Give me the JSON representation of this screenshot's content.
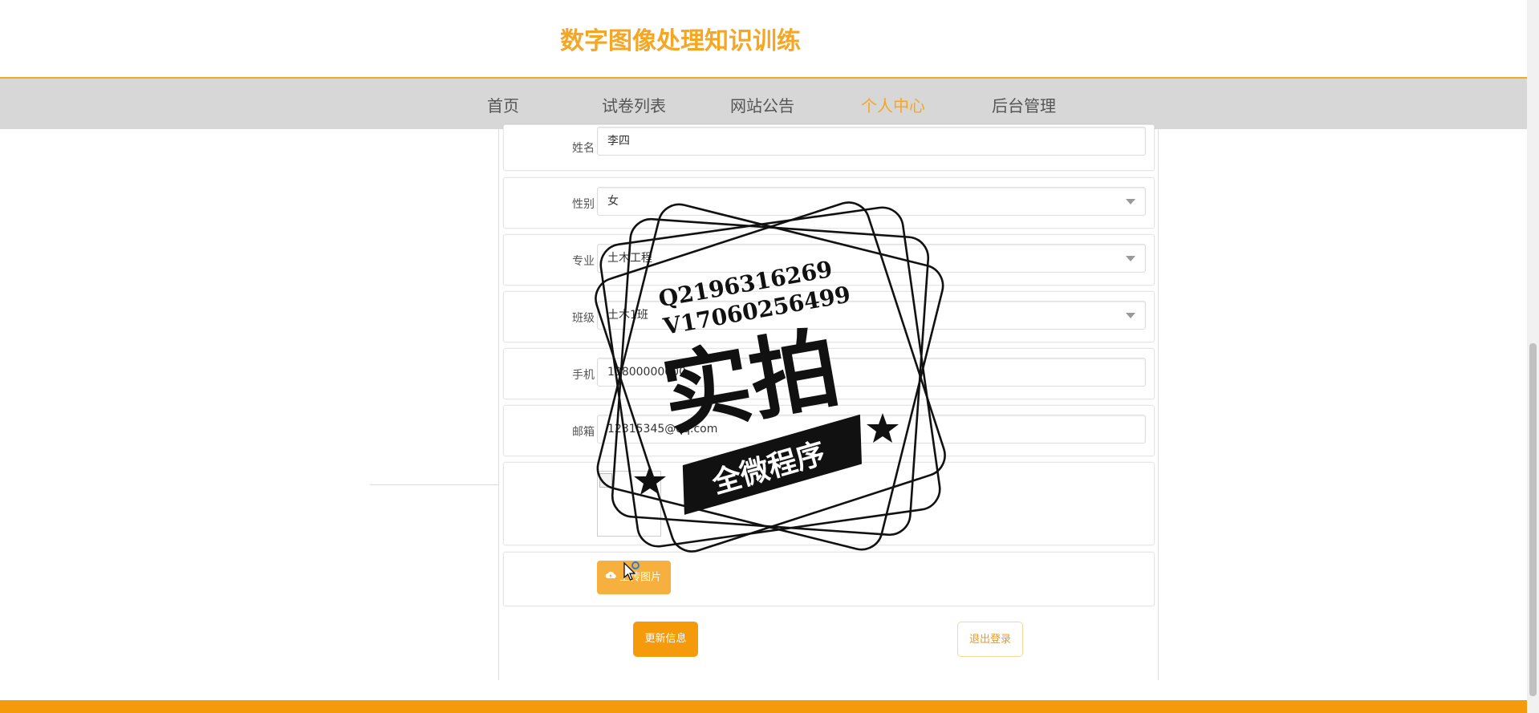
{
  "site": {
    "title": "数字图像处理知识训练"
  },
  "nav": {
    "items": [
      {
        "label": "首页"
      },
      {
        "label": "试卷列表"
      },
      {
        "label": "网站公告"
      },
      {
        "label": "个人中心",
        "active": true
      },
      {
        "label": "后台管理"
      }
    ]
  },
  "form": {
    "name": {
      "label": "姓名",
      "value": "李四"
    },
    "gender": {
      "label": "性别",
      "value": "女"
    },
    "major": {
      "label": "专业",
      "value": "土木工程"
    },
    "class": {
      "label": "班级",
      "value": "土木1班"
    },
    "phone": {
      "label": "手机",
      "value": "13800000000"
    },
    "email": {
      "label": "邮箱",
      "value": "12315345@qq.com"
    },
    "upload_label": "上传图片"
  },
  "actions": {
    "update_label": "更新信息",
    "logout_label": "退出登录"
  },
  "watermark": {
    "line1": "Q2196316269",
    "line2": "V17060256499",
    "big_text": "实拍",
    "banner_text": "全微程序"
  },
  "colors": {
    "accent": "#f5a623",
    "nav_bg": "#d7d7d7",
    "footer": "#f59a0a"
  }
}
